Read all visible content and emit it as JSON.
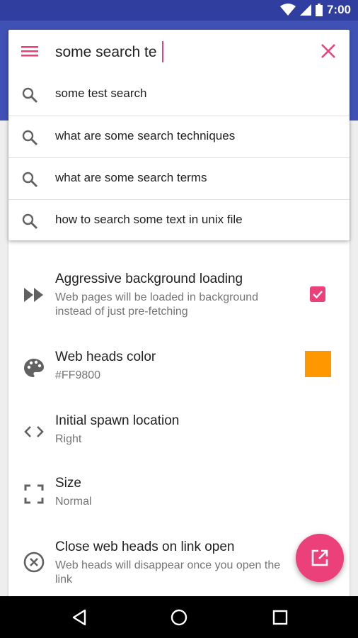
{
  "status_bar": {
    "time": "7:00"
  },
  "search": {
    "query": "some search te",
    "suggestions": [
      "some test search",
      "what are some search techniques",
      "what are some search terms",
      "how to search some text in unix file"
    ]
  },
  "settings": [
    {
      "title": "Aggressive background loading",
      "summary": "Web pages will be loaded in background instead of just pre-fetching",
      "icon": "fast-forward-icon",
      "checked": true
    },
    {
      "title": "Web heads color",
      "summary": "#FF9800",
      "icon": "palette-icon",
      "color": "#FF9800"
    },
    {
      "title": "Initial spawn location",
      "summary": "Right",
      "icon": "code-brackets-icon"
    },
    {
      "title": "Size",
      "summary": "Normal",
      "icon": "fullscreen-icon"
    },
    {
      "title": "Close web heads on link open",
      "summary": "Web heads will disappear once you open the link",
      "icon": "close-circle-icon"
    }
  ],
  "colors": {
    "primary": "#3F51B5",
    "primary_dark": "#303F9F",
    "accent": "#EC407A",
    "web_heads": "#FF9800"
  }
}
